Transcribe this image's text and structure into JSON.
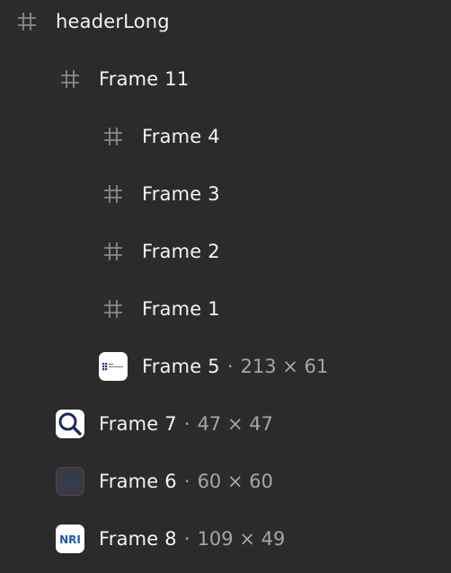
{
  "layers": [
    {
      "name": "headerLong",
      "type": "frame",
      "level": 0
    },
    {
      "name": "Frame 11",
      "type": "frame",
      "level": 1
    },
    {
      "name": "Frame 4",
      "type": "frame",
      "level": 2
    },
    {
      "name": "Frame 3",
      "type": "frame",
      "level": 2
    },
    {
      "name": "Frame 2",
      "type": "frame",
      "level": 2
    },
    {
      "name": "Frame 1",
      "type": "frame",
      "level": 2
    },
    {
      "name": "Frame 5",
      "type": "image",
      "level": 2,
      "separator": "·",
      "dimensions": "213 × 61",
      "thumbnail": "logo-thumbnail"
    },
    {
      "name": "Frame 7",
      "type": "image",
      "level": 1,
      "separator": "·",
      "dimensions": "47 × 47",
      "thumbnail": "search-icon"
    },
    {
      "name": "Frame 6",
      "type": "image",
      "level": 1,
      "separator": "·",
      "dimensions": "60 × 60",
      "thumbnail": "hamburger-menu-icon"
    },
    {
      "name": "Frame 8",
      "type": "image",
      "level": 1,
      "separator": "·",
      "dimensions": "109 × 49",
      "thumbnail": "nri-logo",
      "thumbnail_text": "NRI"
    }
  ],
  "colors": {
    "background": "#2b2b2b",
    "text": "#f3f3f3",
    "muted_text": "#a6a6a6",
    "frame_icon": "#8a8a8a",
    "search_blue": "#1b2a5e",
    "nri_blue": "#1f5aa6"
  }
}
